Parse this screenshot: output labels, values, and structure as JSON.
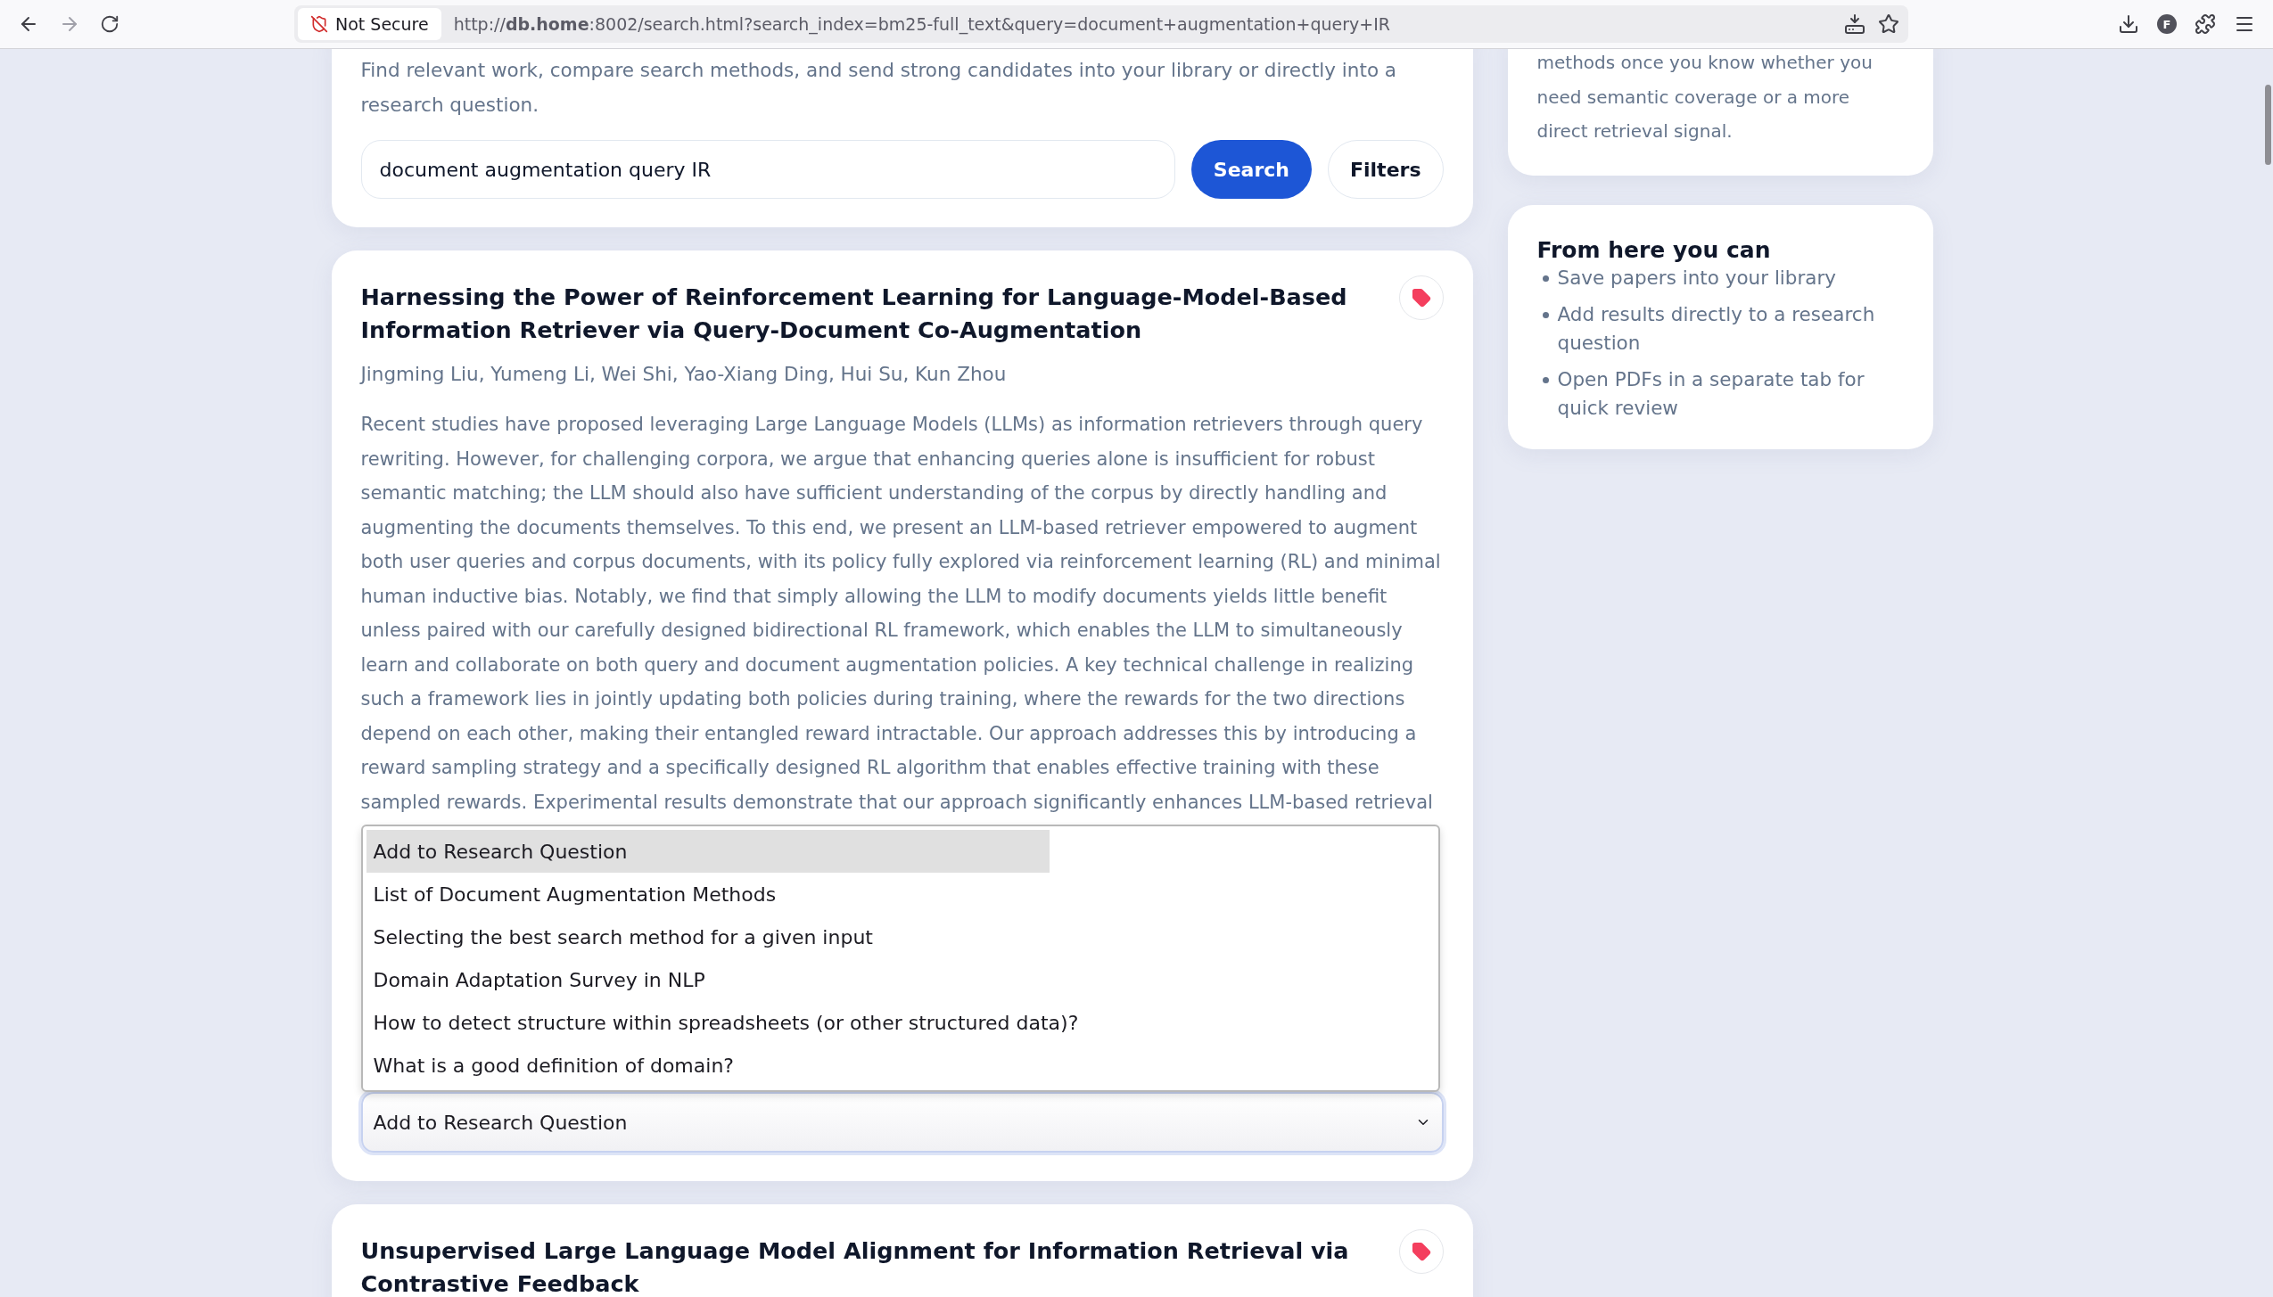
{
  "browser": {
    "security_label": "Not Secure",
    "address": "http://**db.home**:8002/search.html?search_index=bm25-full_text&query=document+augmentation+query+IR",
    "profile_initial": "F"
  },
  "search_card": {
    "intro": "Find relevant work, compare search methods, and send strong candidates into your library or directly into a research question.",
    "query": "document augmentation query IR",
    "search_button": "Search",
    "filters_button": "Filters"
  },
  "results": [
    {
      "title": "Harnessing the Power of Reinforcement Learning for Language-Model-Based Information Retriever via Query-Document Co-Augmentation",
      "authors": "Jingming Liu, Yumeng Li, Wei Shi, Yao-Xiang Ding, Hui Su, Kun Zhou",
      "abstract": "Recent studies have proposed leveraging Large Language Models (LLMs) as information retrievers through query rewriting. However, for challenging corpora, we argue that enhancing queries alone is insufficient for robust semantic matching; the LLM should also have sufficient understanding of the corpus by directly handling and augmenting the documents themselves. To this end, we present an LLM-based retriever empowered to augment both user queries and corpus documents, with its policy fully explored via reinforcement learning (RL) and minimal human inductive bias. Notably, we find that simply allowing the LLM to modify documents yields little benefit unless paired with our carefully designed bidirectional RL framework, which enables the LLM to simultaneously learn and collaborate on both query and document augmentation policies. A key technical challenge in realizing such a framework lies in jointly updating both policies during training, where the rewards for the two directions depend on each other, making their entangled reward intractable. Our approach addresses this by introducing a reward sampling strategy and a specifically designed RL algorithm that enables effective training with these sampled rewards. Experimental results demonstrate that our approach significantly enhances LLM-based retrieval",
      "select": {
        "value": "Add to Research Question",
        "expanded": true,
        "options": [
          {
            "label": "Add to Research Question",
            "selected": true
          },
          {
            "label": "List of Document Augmentation Methods",
            "selected": false
          },
          {
            "label": "Selecting the best search method for a given input",
            "selected": false
          },
          {
            "label": "Domain Adaptation Survey in NLP",
            "selected": false
          },
          {
            "label": "How to detect structure within spreadsheets (or other structured data)?",
            "selected": false
          },
          {
            "label": "What is a good definition of domain?",
            "selected": false
          }
        ]
      }
    },
    {
      "title": "Unsupervised Large Language Model Alignment for Information Retrieval via Contrastive Feedback"
    }
  ],
  "sidebar": {
    "tip_text": "methods once you know whether you need semantic coverage or a more direct retrieval signal.",
    "actions_title": "From here you can",
    "actions": [
      "Save papers into your library",
      "Add results directly to a research question",
      "Open PDFs in a separate tab for quick review"
    ]
  }
}
